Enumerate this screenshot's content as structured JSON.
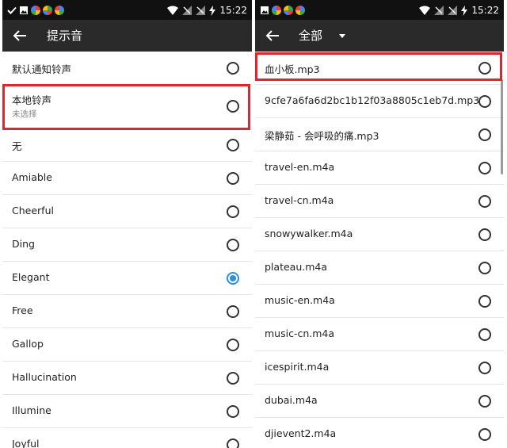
{
  "colors": {
    "statusbar": "#111111",
    "appbar": "#2a2a2a",
    "accent": "#2e8fdc",
    "highlight": "#e3242b"
  },
  "left": {
    "statusbar": {
      "time": "15:22",
      "icons_left": [
        "check-icon",
        "image-icon",
        "app-icon",
        "app-icon",
        "app-icon"
      ],
      "icons_right": [
        "wifi-icon",
        "signal-icon",
        "signal-icon",
        "battery-charging-icon"
      ]
    },
    "appbar": {
      "title": "提示音",
      "back_icon": "arrow-back-icon"
    },
    "items": [
      {
        "label": "默认通知铃声",
        "checked": false
      },
      {
        "label": "本地铃声",
        "subtitle": "未选择",
        "checked": false
      },
      {
        "label": "无",
        "checked": false
      },
      {
        "label": "Amiable",
        "checked": false
      },
      {
        "label": "Cheerful",
        "checked": false
      },
      {
        "label": "Ding",
        "checked": false
      },
      {
        "label": "Elegant",
        "checked": true
      },
      {
        "label": "Free",
        "checked": false
      },
      {
        "label": "Gallop",
        "checked": false
      },
      {
        "label": "Hallucination",
        "checked": false
      },
      {
        "label": "Illumine",
        "checked": false
      },
      {
        "label": "Joyful",
        "checked": false
      }
    ]
  },
  "right": {
    "statusbar": {
      "time": "15:22",
      "icons_left": [
        "image-icon",
        "app-icon",
        "app-icon",
        "app-icon"
      ],
      "icons_right": [
        "wifi-icon",
        "signal-icon",
        "signal-icon",
        "battery-charging-icon"
      ]
    },
    "appbar": {
      "title": "全部",
      "back_icon": "arrow-back-icon",
      "dropdown_icon": "caret-down-icon"
    },
    "items": [
      {
        "label": "血小板.mp3",
        "checked": false
      },
      {
        "label": "9cfe7a6fa6d2bc1b12f03a8805c1eb7d.mp3",
        "checked": false
      },
      {
        "label": "梁静茹 - 会呼吸的痛.mp3",
        "checked": false
      },
      {
        "label": "travel-en.m4a",
        "checked": false
      },
      {
        "label": "travel-cn.m4a",
        "checked": false
      },
      {
        "label": "snowywalker.m4a",
        "checked": false
      },
      {
        "label": "plateau.m4a",
        "checked": false
      },
      {
        "label": "music-en.m4a",
        "checked": false
      },
      {
        "label": "music-cn.m4a",
        "checked": false
      },
      {
        "label": "icespirit.m4a",
        "checked": false
      },
      {
        "label": "dubai.m4a",
        "checked": false
      },
      {
        "label": "djievent2.m4a",
        "checked": false
      }
    ]
  }
}
